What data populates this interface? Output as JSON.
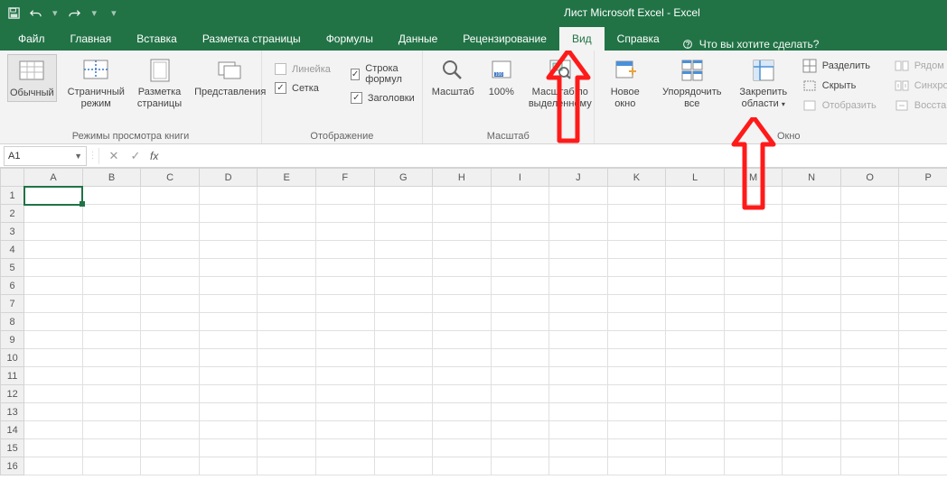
{
  "title": "Лист Microsoft Excel  -  Excel",
  "tabs": {
    "file": "Файл",
    "home": "Главная",
    "insert": "Вставка",
    "page_layout": "Разметка страницы",
    "formulas": "Формулы",
    "data": "Данные",
    "review": "Рецензирование",
    "view": "Вид",
    "help": "Справка",
    "tellme": "Что вы хотите сделать?"
  },
  "ribbon": {
    "views": {
      "normal": "Обычный",
      "page_break": "Страничный режим",
      "page_layout": "Разметка страницы",
      "custom_views": "Представления",
      "group_label": "Режимы просмотра книги"
    },
    "show": {
      "ruler": "Линейка",
      "formula_bar": "Строка формул",
      "gridlines": "Сетка",
      "headings": "Заголовки",
      "group_label": "Отображение"
    },
    "zoom": {
      "zoom": "Масштаб",
      "hundred": "100%",
      "to_selection_l1": "Масштаб по",
      "to_selection_l2": "выделенному",
      "group_label": "Масштаб"
    },
    "window": {
      "new": "Новое окно",
      "arrange": "Упорядочить все",
      "freeze_l1": "Закрепить",
      "freeze_l2": "области",
      "split": "Разделить",
      "hide": "Скрыть",
      "unhide": "Отобразить",
      "side_by_side": "Рядом",
      "sync_scroll": "Синхронна",
      "reset_pos": "Восстанови",
      "group_label": "Окно"
    }
  },
  "namebox": "A1",
  "columns": [
    "A",
    "B",
    "C",
    "D",
    "E",
    "F",
    "G",
    "H",
    "I",
    "J",
    "K",
    "L",
    "M",
    "N",
    "O",
    "P"
  ],
  "rows": [
    1,
    2,
    3,
    4,
    5,
    6,
    7,
    8,
    9,
    10,
    11,
    12,
    13,
    14,
    15,
    16
  ],
  "selected_cell": "A1"
}
